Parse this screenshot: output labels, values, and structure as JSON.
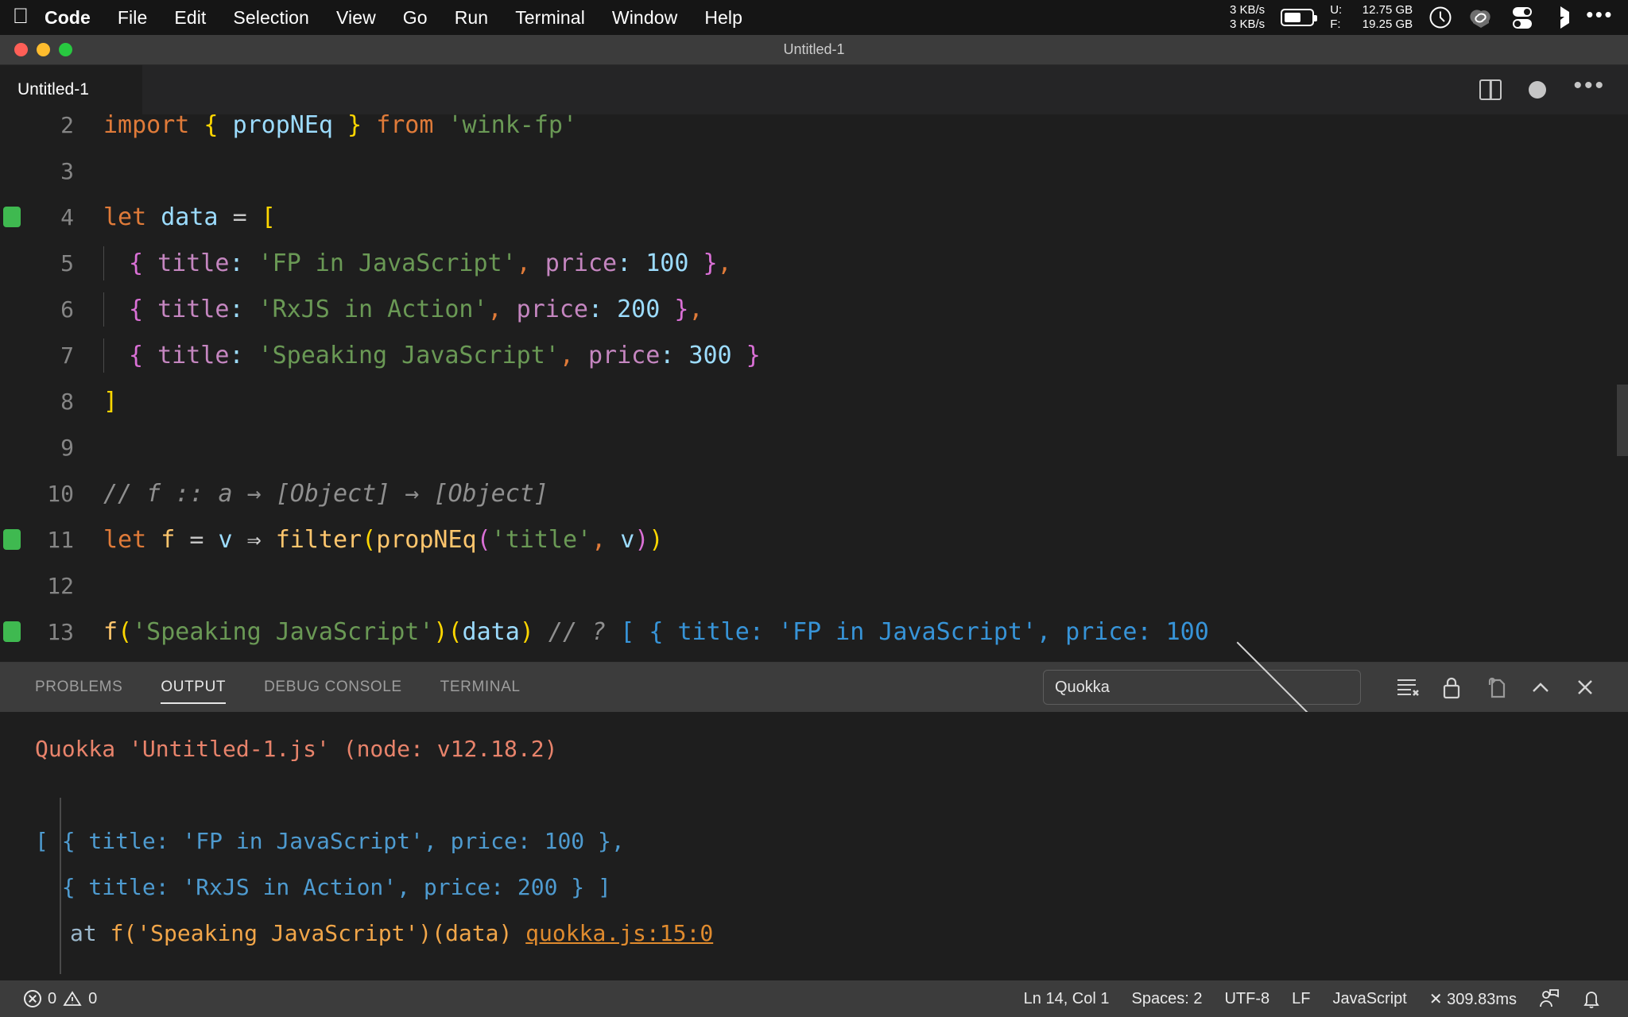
{
  "menubar": {
    "apple_icon": "apple-logo-icon",
    "items": [
      "Code",
      "File",
      "Edit",
      "Selection",
      "View",
      "Go",
      "Run",
      "Terminal",
      "Window",
      "Help"
    ],
    "network_up": "3 KB/s",
    "network_down": "3 KB/s",
    "battery_icon": "battery-icon",
    "disk_used_label": "U:",
    "disk_used_value": "12.75 GB",
    "disk_free_label": "F:",
    "disk_free_value": "19.25 GB",
    "clock_icon": "clock-icon",
    "cloud_icon": "cloud-sync-icon",
    "toggles_icon": "toggles-icon",
    "shape_icon": "diamond-icon",
    "overflow_icon": "ellipsis-icon"
  },
  "window": {
    "title": "Untitled-1",
    "traffic_lights": [
      "close",
      "minimize",
      "zoom"
    ]
  },
  "tabbar": {
    "tabs": [
      {
        "label": "Untitled-1",
        "active": true,
        "dirty": true
      }
    ],
    "actions": [
      {
        "name": "split-editor-icon"
      },
      {
        "name": "unsaved-dot-icon"
      },
      {
        "name": "more-actions-icon"
      }
    ]
  },
  "editor": {
    "language": "JavaScript",
    "lines": [
      {
        "num": "2",
        "marker": false,
        "indent": false
      },
      {
        "num": "3",
        "marker": false,
        "indent": false
      },
      {
        "num": "4",
        "marker": true,
        "indent": false
      },
      {
        "num": "5",
        "marker": false,
        "indent": true
      },
      {
        "num": "6",
        "marker": false,
        "indent": true
      },
      {
        "num": "7",
        "marker": false,
        "indent": true
      },
      {
        "num": "8",
        "marker": false,
        "indent": false
      },
      {
        "num": "9",
        "marker": false,
        "indent": false
      },
      {
        "num": "10",
        "marker": false,
        "indent": false
      },
      {
        "num": "11",
        "marker": true,
        "indent": false
      },
      {
        "num": "12",
        "marker": false,
        "indent": false
      },
      {
        "num": "13",
        "marker": true,
        "indent": false
      }
    ],
    "code": {
      "l2_import": "import",
      "l2_brace_open": " { ",
      "l2_named": "propNEq",
      "l2_brace_close": " } ",
      "l2_from": "from",
      "l2_module": " 'wink-fp'",
      "l4_let": "let",
      "l4_name": " data ",
      "l4_eq": "= ",
      "l4_bracket": "[",
      "l5_obj_open": "{ ",
      "l5_key": "title",
      "l5_colon": ": ",
      "l5_value": "'FP in JavaScript'",
      "l5_comma": ", ",
      "l5_key2": "price",
      "l5_colon2": ": ",
      "l5_num": "100",
      "l5_obj_close": " }",
      "l5_tail": ",",
      "l6_value": "'RxJS in Action'",
      "l6_num": "200",
      "l7_value": "'Speaking JavaScript'",
      "l7_num": "300",
      "l8_bracket": "]",
      "l10_comment": "// f :: a → [Object] → [Object]",
      "l11_let": "let",
      "l11_fname": " f ",
      "l11_eq": "= ",
      "l11_param": "v ",
      "l11_arrow": "⇒ ",
      "l11_filter": "filter",
      "l11_p1": "(",
      "l11_propneq": "propNEq",
      "l11_p2": "(",
      "l11_str": "'title'",
      "l11_comma": ", ",
      "l11_v": "v",
      "l11_p3": ")",
      "l11_p4": ")",
      "l13_f": "f",
      "l13_p1": "(",
      "l13_str": "'Speaking JavaScript'",
      "l13_p2": ")",
      "l13_p3": "(",
      "l13_data": "data",
      "l13_p4": ")",
      "l13_comment": " // ? ",
      "l13_result": "[ { title: 'FP in JavaScript', price: 100"
    }
  },
  "panel": {
    "tabs": [
      {
        "label": "PROBLEMS",
        "active": false
      },
      {
        "label": "OUTPUT",
        "active": true
      },
      {
        "label": "DEBUG CONSOLE",
        "active": false
      },
      {
        "label": "TERMINAL",
        "active": false
      }
    ],
    "channel_selected": "Quokka",
    "tools": [
      {
        "name": "clear-output-icon"
      },
      {
        "name": "lock-scroll-icon"
      },
      {
        "name": "open-in-editor-icon"
      },
      {
        "name": "collapse-panel-icon"
      },
      {
        "name": "close-panel-icon"
      }
    ],
    "output": {
      "header": "Quokka 'Untitled-1.js' (node: v12.18.2)",
      "line1": "[ { title: 'FP in JavaScript', price: 100 },",
      "line2": "  { title: 'RxJS in Action', price: 200 } ]",
      "line3_at": "at ",
      "line3_call": "f('Speaking JavaScript')(data) ",
      "line3_link": "quokka.js:15:0"
    }
  },
  "statusbar": {
    "errors": "0",
    "warnings": "0",
    "cursor": "Ln 14, Col 1",
    "indentation": "Spaces: 2",
    "encoding": "UTF-8",
    "eol": "LF",
    "language": "JavaScript",
    "quokka_time": "✕ 309.83ms",
    "feedback_icon": "feedback-person-icon",
    "bell_icon": "bell-icon"
  }
}
